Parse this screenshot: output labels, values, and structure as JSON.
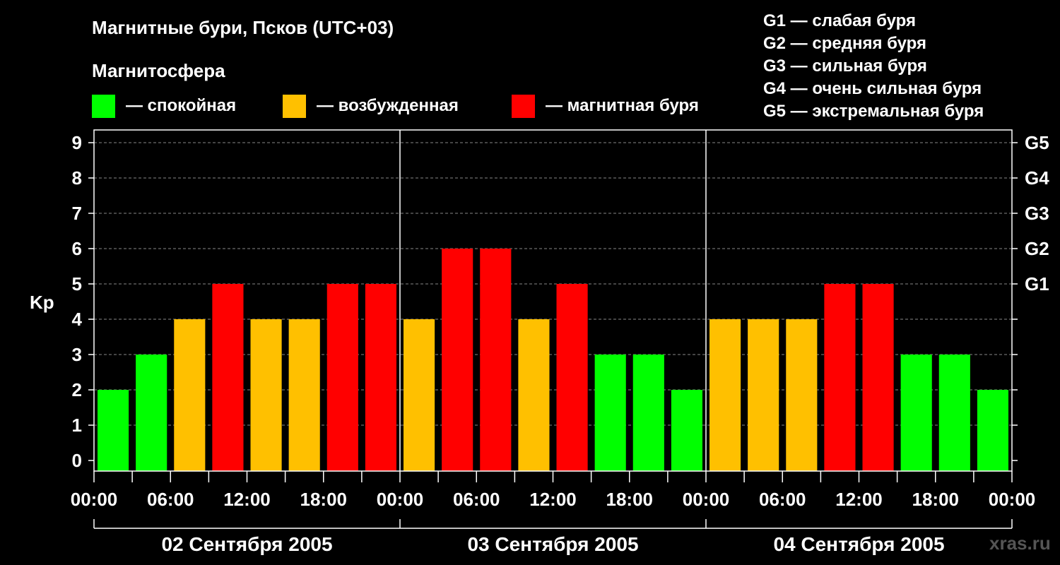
{
  "title": "Магнитные бури, Псков (UTC+03)",
  "legend_title": "Магнитосфера",
  "legend": [
    {
      "label": "— спокойная",
      "color": "#00ff00"
    },
    {
      "label": "— возбужденная",
      "color": "#ffc000"
    },
    {
      "label": "— магнитная буря",
      "color": "#ff0000"
    }
  ],
  "g_scale": [
    "G1 — слабая буря",
    "G2 — средняя буря",
    "G3 — сильная буря",
    "G4 — очень сильная буря",
    "G5 — экстремальная буря"
  ],
  "watermark": "xras.ru",
  "chart_data": {
    "type": "bar",
    "ylabel": "Kp",
    "ylim": [
      0,
      9
    ],
    "yticks": [
      "0",
      "1",
      "2",
      "3",
      "4",
      "5",
      "6",
      "7",
      "8",
      "9"
    ],
    "right_ticks": [
      {
        "value": 5,
        "label": "G1"
      },
      {
        "value": 6,
        "label": "G2"
      },
      {
        "value": 7,
        "label": "G3"
      },
      {
        "value": 8,
        "label": "G4"
      },
      {
        "value": 9,
        "label": "G5"
      }
    ],
    "x_tick_labels": [
      "00:00",
      "06:00",
      "12:00",
      "18:00",
      "00:00",
      "06:00",
      "12:00",
      "18:00",
      "00:00",
      "06:00",
      "12:00",
      "18:00",
      "00:00"
    ],
    "days": [
      "02 Сентября 2005",
      "03 Сентября 2005",
      "04 Сентября 2005"
    ],
    "values": [
      2,
      3,
      4,
      5,
      4,
      4,
      5,
      5,
      4,
      6,
      6,
      4,
      5,
      3,
      3,
      2,
      4,
      4,
      4,
      5,
      5,
      3,
      3,
      2
    ],
    "colors": {
      "quiet": "#00ff00",
      "active": "#ffc000",
      "storm": "#ff0000"
    },
    "grid": true
  }
}
